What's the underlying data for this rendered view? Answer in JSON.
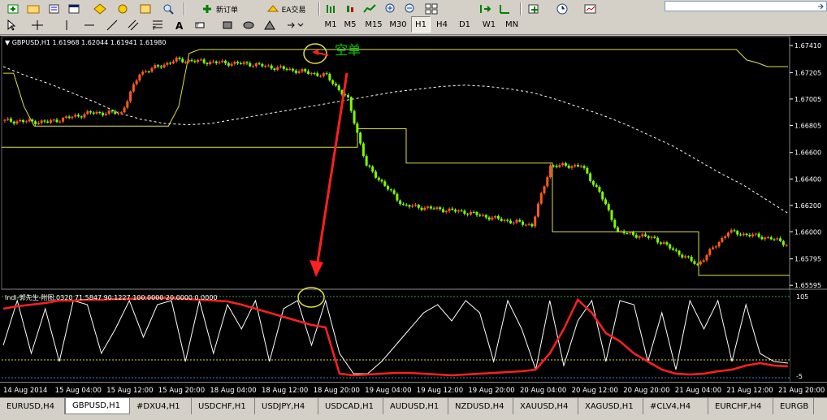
{
  "toolbar": {
    "new_order_label": "新订单",
    "ea_label": "EA交易",
    "timeframes": [
      "M1",
      "M5",
      "M15",
      "M30",
      "H1",
      "H4",
      "D1",
      "W1",
      "MN"
    ],
    "active_timeframe": "H1"
  },
  "chart": {
    "info_line": "GBPUSD,H1  1.61968 1.62044 1.61941 1.61980",
    "annotation_text": "空单",
    "price_ticks": [
      "1.67410",
      "1.67205",
      "1.67005",
      "1.66805",
      "1.66600",
      "1.66400",
      "1.66200",
      "1.66000",
      "1.65795",
      "1.65595"
    ],
    "annotation_color": "#00cc00",
    "arrow_color": "#ff0000"
  },
  "indicator": {
    "info_line": "Indi-郭先生-附图,0320 71.5847 90.1227 100.0000 20.0000 0.0000",
    "scale_top": "105",
    "scale_bottom": "-5",
    "scale_bottom_extra": "0"
  },
  "time_axis": {
    "labels": [
      "14 Aug 2014",
      "15 Aug 04:00",
      "15 Aug 12:00",
      "15 Aug 20:00",
      "18 Aug 04:00",
      "18 Aug 12:00",
      "18 Aug 20:00",
      "19 Aug 04:00",
      "19 Aug 12:00",
      "19 Aug 20:00",
      "20 Aug 04:00",
      "20 Aug 12:00",
      "20 Aug 20:00",
      "21 Aug 04:00",
      "21 Aug 12:00",
      "21 Aug 20:00"
    ]
  },
  "tabs": {
    "items": [
      "EURUSD,H4",
      "GBPUSD,H1",
      "#DXU4,H1",
      "USDCHF,H1",
      "USDJPY,H4",
      "USDCAD,H1",
      "AUDUSD,H1",
      "NZDUSD,H4",
      "XAUUSD,H4",
      "XAGUSD,H1",
      "#CLV4,H4",
      "EURCHF,H4",
      "EURGB"
    ],
    "active": "GBPUSD,H1"
  },
  "chart_data": {
    "type": "candlestick",
    "symbol": "GBPUSD",
    "timeframe": "H1",
    "ylim": [
      1.6559,
      1.6741
    ],
    "open": 1.61968,
    "high": 1.62044,
    "low": 1.61941,
    "close": 1.6198,
    "upper_band": [
      1.672,
      1.672,
      1.6695,
      1.668,
      1.668,
      1.668,
      1.668,
      1.668,
      1.668,
      1.668,
      1.668,
      1.668,
      1.668,
      1.668,
      1.668,
      1.668,
      1.668,
      1.6695,
      1.6735,
      1.6738,
      1.6738,
      1.6738,
      1.6738,
      1.6738,
      1.6738,
      1.6738,
      1.6738,
      1.6738,
      1.6738,
      1.6738,
      1.6738,
      1.6738,
      1.6738,
      1.6738,
      1.6738,
      1.6738,
      1.6738,
      1.6738,
      1.6738,
      1.6738,
      1.6738,
      1.6738,
      1.6738,
      1.6738,
      1.6738,
      1.6738,
      1.6738,
      1.6738,
      1.6738,
      1.6738,
      1.6738,
      1.6738,
      1.6738,
      1.6738,
      1.6738,
      1.6738,
      1.6738,
      1.6738,
      1.6738,
      1.6738,
      1.6738,
      1.6738,
      1.6738,
      1.6738,
      1.6738,
      1.6738,
      1.6738,
      1.6738,
      1.6738,
      1.6738,
      1.6738,
      1.6738,
      1.673,
      1.6728,
      1.6725,
      1.6725,
      1.6725
    ],
    "support_levels": [
      1.6664,
      1.6678,
      1.6652,
      1.66,
      1.6567
    ],
    "moving_average": [
      1.6725,
      1.6718,
      1.6712,
      1.6705,
      1.6698,
      1.669,
      1.6685,
      1.6682,
      1.6681,
      1.6682,
      1.6685,
      1.6688,
      1.6691,
      1.6694,
      1.6697,
      1.67,
      1.6703,
      1.6706,
      1.6708,
      1.671,
      1.6711,
      1.671,
      1.6708,
      1.6705,
      1.67,
      1.6694,
      1.6688,
      1.6681,
      1.6673,
      1.6665,
      1.6655,
      1.6645,
      1.6636,
      1.6625,
      1.6614
    ],
    "indicator": {
      "ylim": [
        -5,
        105
      ],
      "levels": [
        100,
        20,
        0
      ],
      "series": [
        {
          "color": "#ff2020",
          "values": [
            85,
            88,
            90,
            92,
            95,
            95,
            96,
            96,
            97,
            97,
            98,
            98,
            98,
            97,
            96,
            95,
            94,
            90,
            85,
            80,
            75,
            70,
            65,
            62,
            5,
            3,
            4,
            5,
            6,
            6,
            5,
            4,
            3,
            4,
            5,
            6,
            7,
            8,
            10,
            30,
            60,
            96,
            80,
            55,
            45,
            30,
            20,
            10,
            5,
            4,
            5,
            8,
            10,
            15,
            18,
            15,
            14
          ]
        },
        {
          "color": "#ffffff",
          "values": [
            40,
            95,
            30,
            85,
            20,
            95,
            90,
            30,
            60,
            95,
            50,
            90,
            95,
            20,
            95,
            30,
            90,
            60,
            95,
            20,
            85,
            95,
            40,
            95,
            30,
            5,
            5,
            20,
            40,
            60,
            80,
            90,
            70,
            95,
            80,
            20,
            95,
            60,
            10,
            95,
            15,
            70,
            95,
            20,
            95,
            90,
            20,
            80,
            10,
            95,
            60,
            95,
            20,
            90,
            30,
            20,
            18
          ]
        }
      ]
    }
  }
}
